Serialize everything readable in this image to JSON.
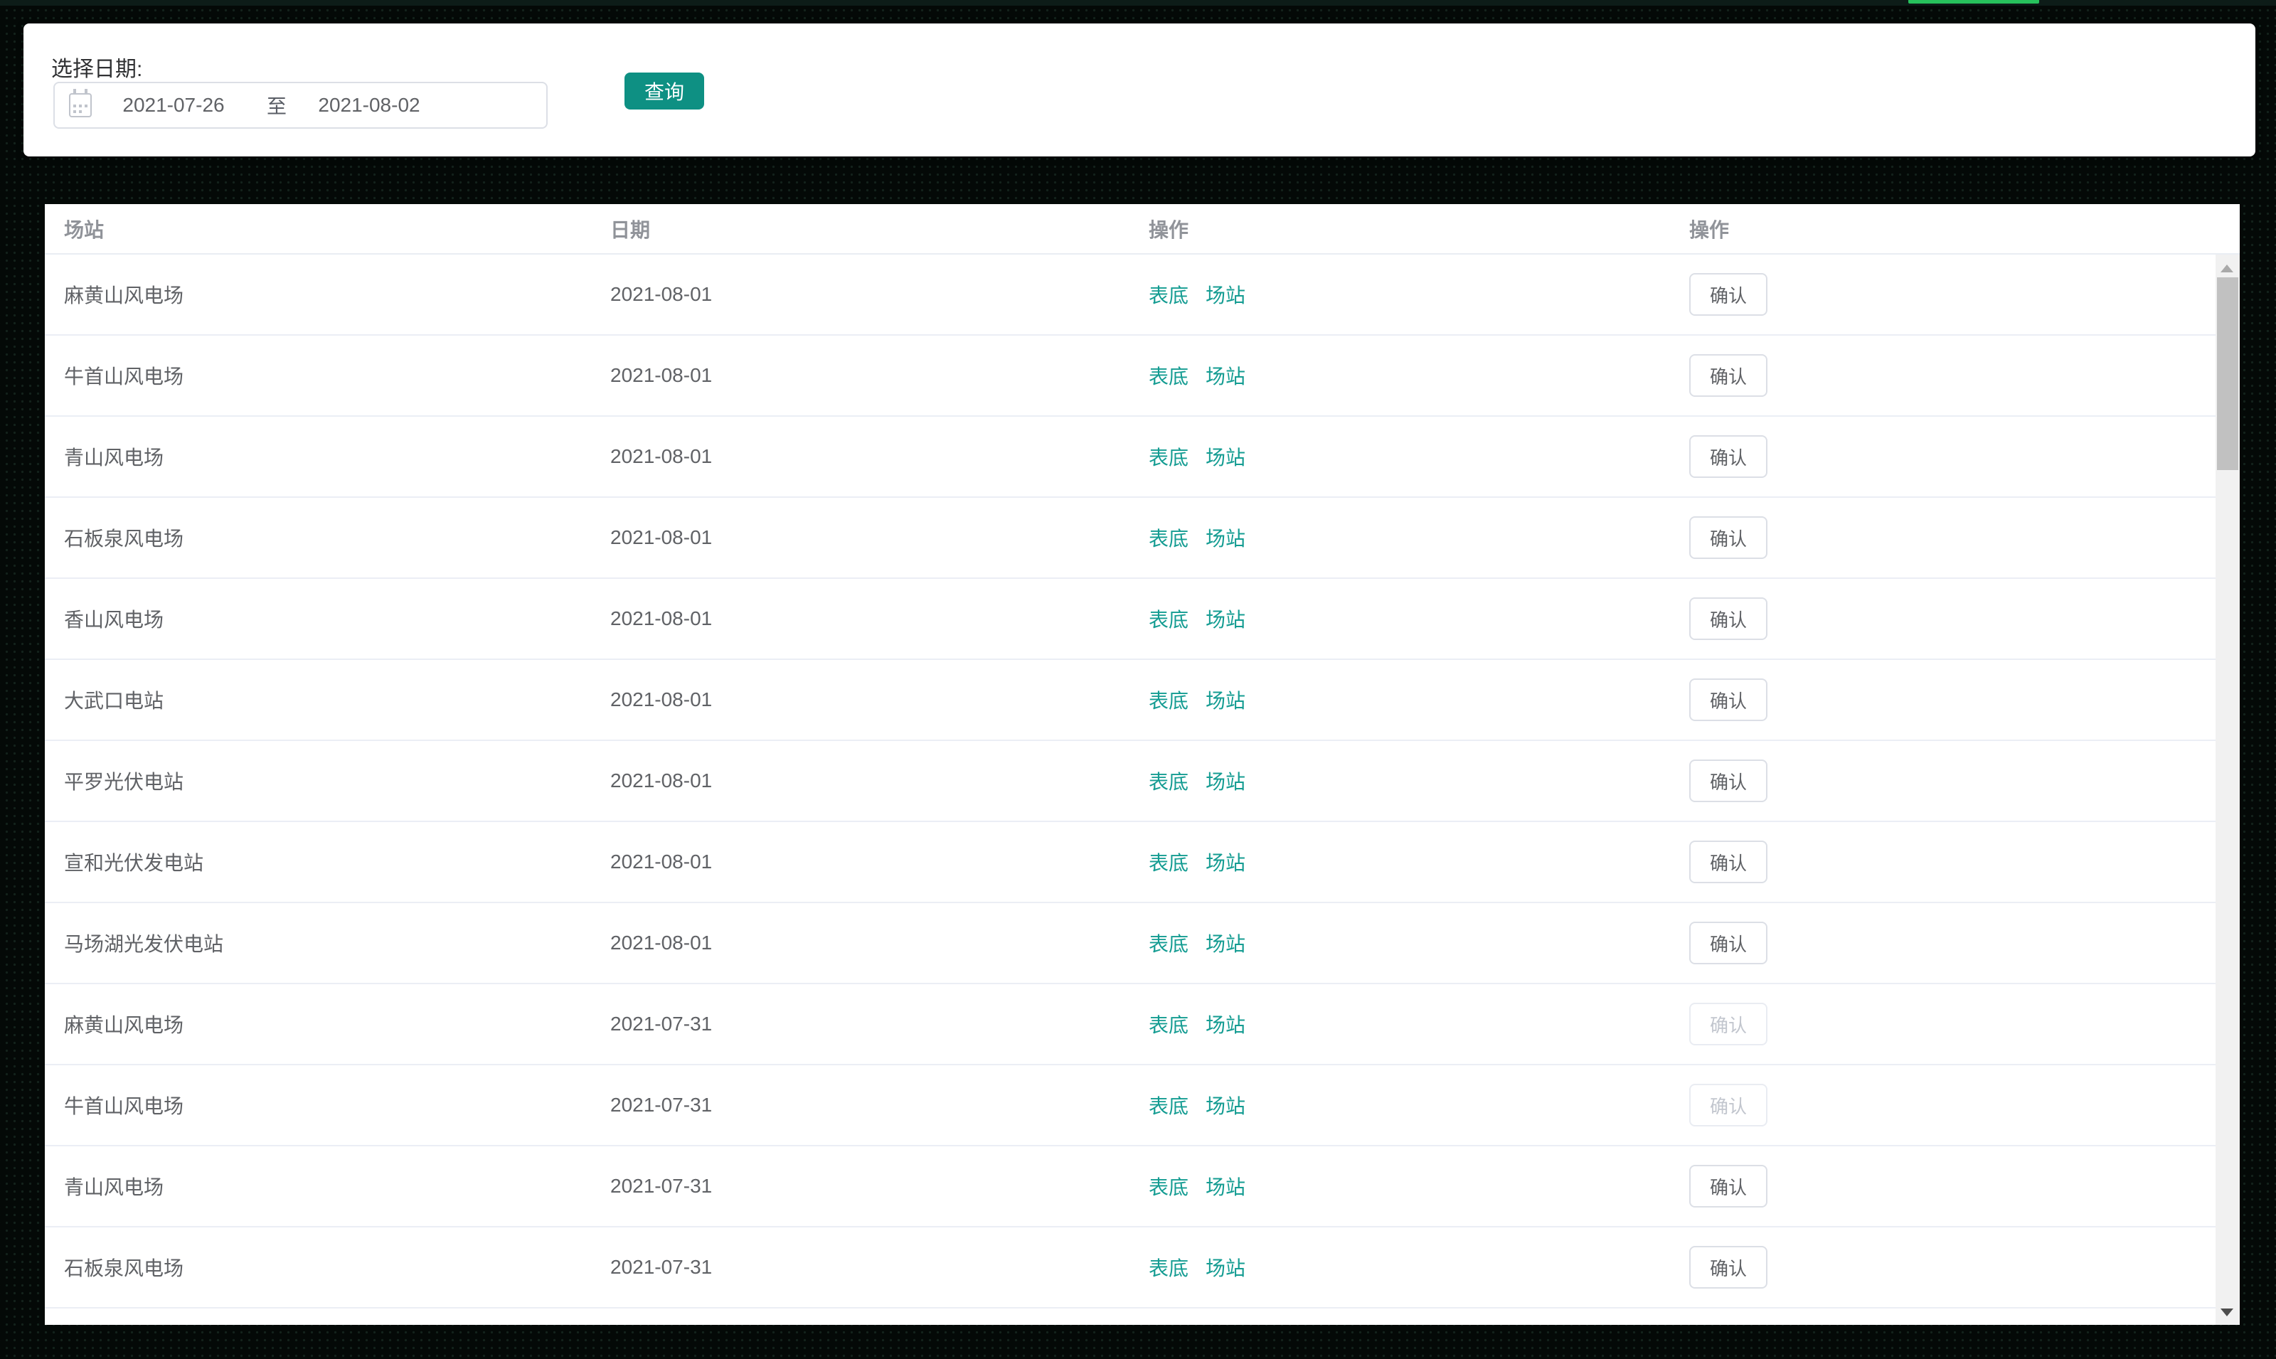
{
  "colors": {
    "accent": "#0E9083",
    "link": "#149C92",
    "green_bar": "#27C15C",
    "page_bg": "#040907",
    "header_text": "#909399",
    "cell_text": "#606266",
    "row_border": "#EBEEF5",
    "button_border": "#DCDFE6",
    "disabled_text": "#C2C6CE",
    "label_text": "#303133",
    "icon_gray": "#C0C4CC"
  },
  "filter": {
    "label": "选择日期:",
    "date_range": {
      "start": "2021-07-26",
      "separator": "至",
      "end": "2021-08-02"
    },
    "query_button": "查询"
  },
  "table": {
    "headers": [
      "场站",
      "日期",
      "操作",
      "操作"
    ],
    "link_labels": [
      "表底",
      "场站"
    ],
    "confirm_label": "确认",
    "rows": [
      {
        "station": "麻黄山风电场",
        "date": "2021-08-01",
        "confirm_enabled": true
      },
      {
        "station": "牛首山风电场",
        "date": "2021-08-01",
        "confirm_enabled": true
      },
      {
        "station": "青山风电场",
        "date": "2021-08-01",
        "confirm_enabled": true
      },
      {
        "station": "石板泉风电场",
        "date": "2021-08-01",
        "confirm_enabled": true
      },
      {
        "station": "香山风电场",
        "date": "2021-08-01",
        "confirm_enabled": true
      },
      {
        "station": "大武口电站",
        "date": "2021-08-01",
        "confirm_enabled": true
      },
      {
        "station": "平罗光伏电站",
        "date": "2021-08-01",
        "confirm_enabled": true
      },
      {
        "station": "宣和光伏发电站",
        "date": "2021-08-01",
        "confirm_enabled": true
      },
      {
        "station": "马场湖光发伏电站",
        "date": "2021-08-01",
        "confirm_enabled": true
      },
      {
        "station": "麻黄山风电场",
        "date": "2021-07-31",
        "confirm_enabled": false
      },
      {
        "station": "牛首山风电场",
        "date": "2021-07-31",
        "confirm_enabled": false
      },
      {
        "station": "青山风电场",
        "date": "2021-07-31",
        "confirm_enabled": true
      },
      {
        "station": "石板泉风电场",
        "date": "2021-07-31",
        "confirm_enabled": true
      }
    ]
  }
}
